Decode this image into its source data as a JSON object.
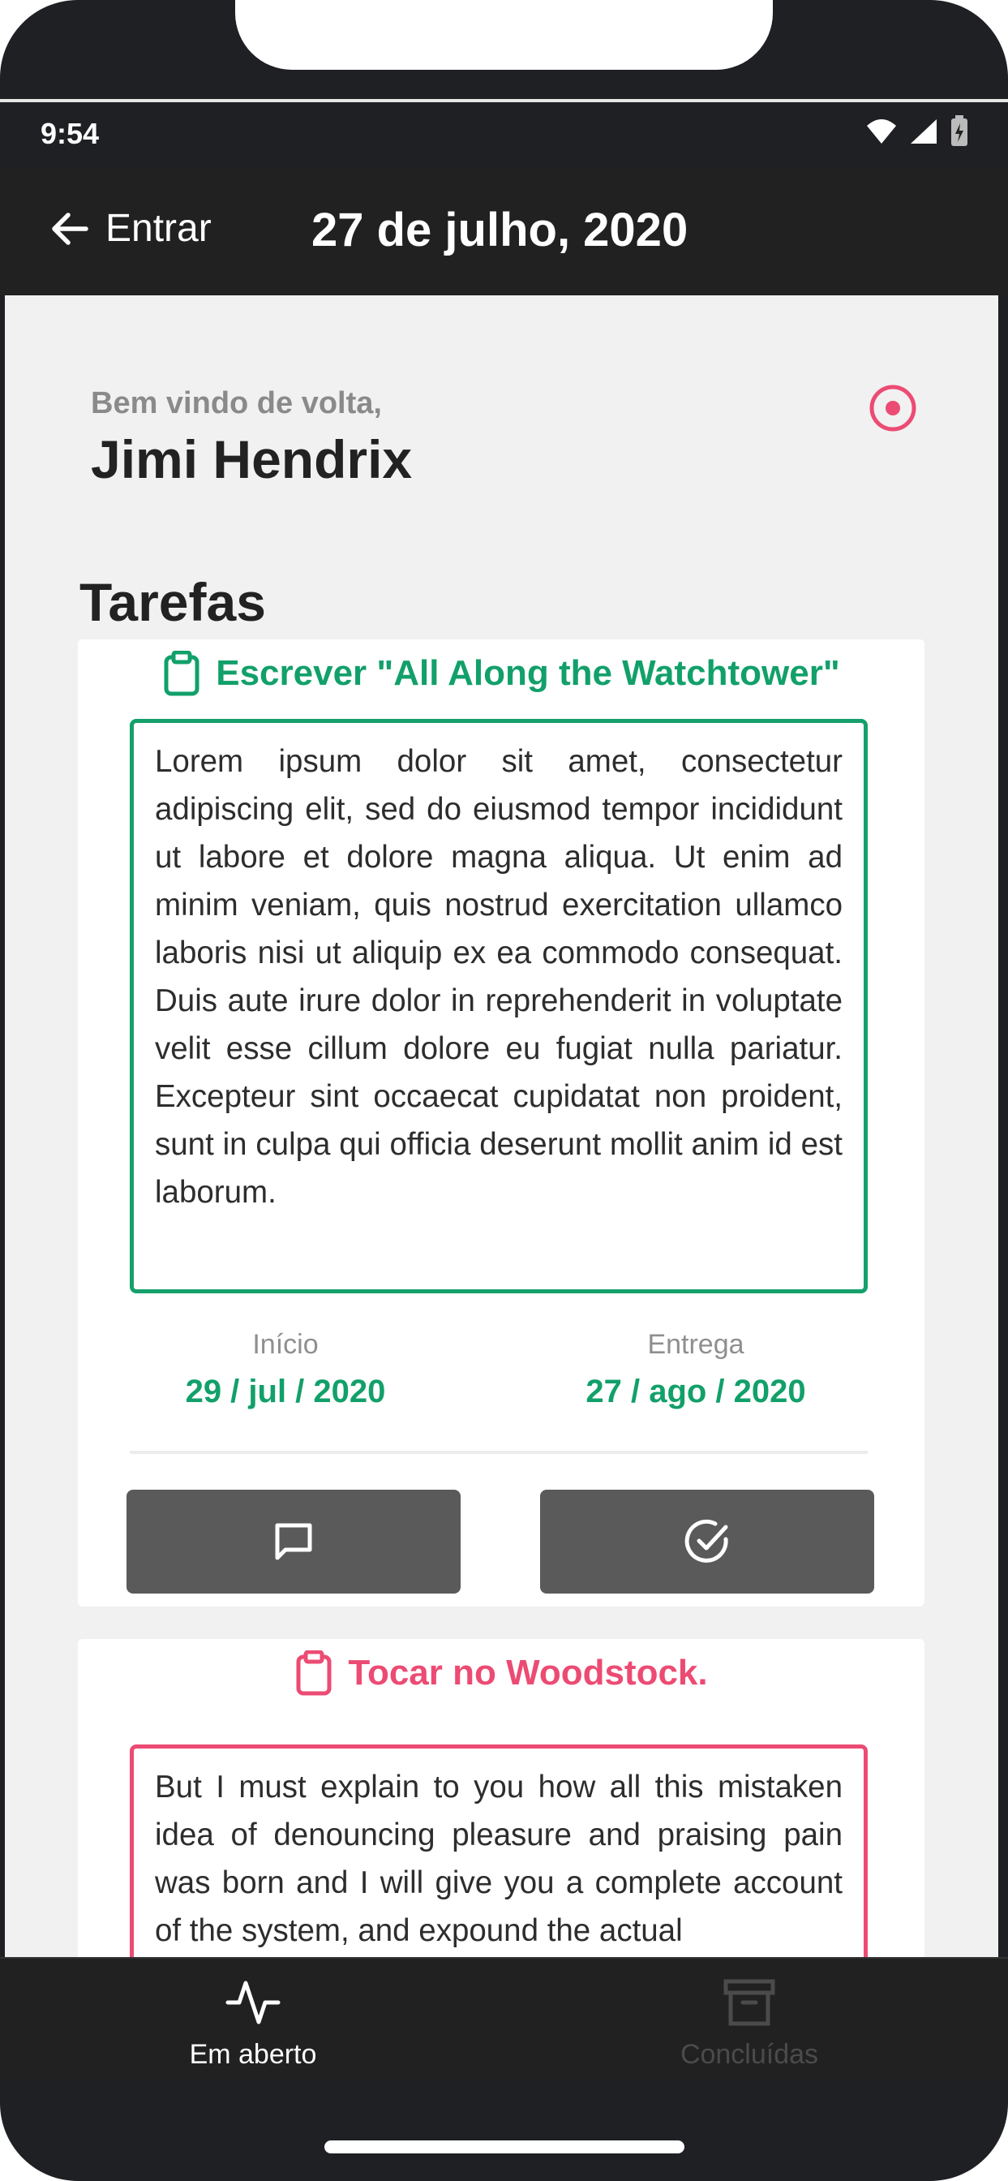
{
  "status_bar": {
    "time": "9:54"
  },
  "header": {
    "back_label": "Entrar",
    "title": "27 de julho, 2020"
  },
  "welcome": {
    "greeting": "Bem vindo de volta,",
    "user_name": "Jimi Hendrix"
  },
  "section_title": "Tarefas",
  "tasks": [
    {
      "title": "Escrever \"All Along the Watchtower\"",
      "description": "Lorem ipsum dolor sit amet, consectetur adipiscing elit, sed do eiusmod tempor incididunt ut labore et dolore magna aliqua. Ut enim ad minim veniam, quis nostrud exercitation ullamco laboris nisi ut aliquip ex ea commodo consequat. Duis aute irure dolor in reprehenderit in voluptate velit esse cillum dolore eu fugiat nulla pariatur. Excepteur sint occaecat cupidatat non proident, sunt in culpa qui officia deserunt mollit anim id est laborum.",
      "start_label": "Início",
      "start_date": "29 / jul / 2020",
      "due_label": "Entrega",
      "due_date": "27 / ago / 2020",
      "accent_color": "#12a06a"
    },
    {
      "title": "Tocar no Woodstock.",
      "description": "But I must explain to you how all this mistaken idea of denouncing pleasure and praising pain was born and I will give you a complete account of the system, and expound the actual",
      "accent_color": "#ec4b73"
    }
  ],
  "bottom_nav": {
    "open_label": "Em aberto",
    "done_label": "Concluídas"
  },
  "icons": {
    "back": "arrow-left-icon",
    "profile": "target-icon",
    "task": "clipboard-icon",
    "comment": "message-square-icon",
    "complete": "check-circle-icon",
    "open": "activity-icon",
    "done": "archive-icon"
  },
  "colors": {
    "green": "#12a06a",
    "pink": "#ec4b73",
    "dark": "#212121",
    "button": "#5a5a5a"
  }
}
